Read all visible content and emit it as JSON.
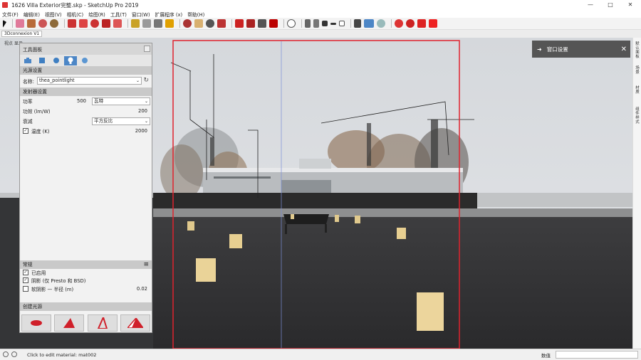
{
  "window": {
    "title": "1626 Villa Exterior完整.skp - SketchUp Pro 2019",
    "minimize": "—",
    "maximize": "□",
    "close": "✕"
  },
  "menu": [
    "文件(F)",
    "编辑(E)",
    "视图(V)",
    "相机(C)",
    "绘图(R)",
    "工具(T)",
    "窗口(W)",
    "扩展程序 (x)",
    "帮助(H)"
  ],
  "scene_tab": "3Dconnexion V1",
  "left_vertical_label": "视点 显示",
  "panel": {
    "title": "工具面板",
    "section_light_source": "光源设置",
    "name_label": "名称:",
    "name_value": "thea_pointlight",
    "section_emitter": "发射器设置",
    "power_label": "功率",
    "power_value": "500",
    "power_unit": "瓦特",
    "efficacy_label": "功效 (lm/W)",
    "efficacy_value": "200",
    "attenuation_label": "衰减",
    "attenuation_value": "平方反比",
    "temperature_label": "温度 (K)",
    "temperature_value": "2000",
    "temperature_checked": true,
    "section_common": "常规",
    "enabled_label": "已启用",
    "shadow_label": "阴影 (仅 Presto 和 BSD)",
    "soft_shadow_label": "软阴影 — 半径 (m)",
    "soft_shadow_value": "0.02",
    "section_create": "创建光源"
  },
  "window_settings": {
    "label": "窗口设置",
    "close": "✕"
  },
  "right_tabs": [
    "默认面板",
    "场景",
    "材质",
    "组件样式"
  ],
  "status": {
    "message": "Click to edit material: mat002",
    "measurements_label": "数值"
  },
  "colors": {
    "accent": "#4c86c6",
    "viewport_frame": "#e0232e",
    "panel_bg": "#f2f2f2"
  }
}
